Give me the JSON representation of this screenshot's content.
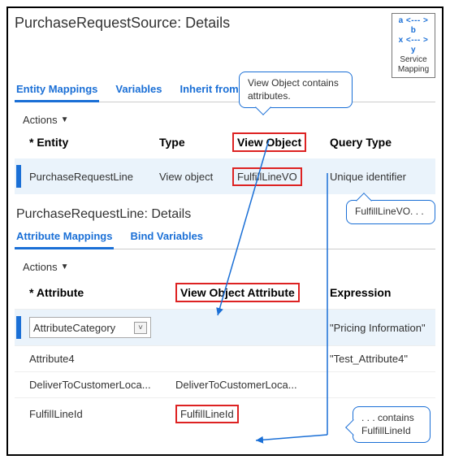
{
  "pageTitle": "PurchaseRequestSource: Details",
  "serviceMapping": {
    "line1": "a <--- > b",
    "line2": "x <--- > y",
    "label1": "Service",
    "label2": "Mapping"
  },
  "tabs": {
    "entityMappings": "Entity Mappings",
    "variables": "Variables",
    "inheritFromServices": "Inherit from Services"
  },
  "actionsLabel": "Actions",
  "entityGrid": {
    "headers": {
      "entity": "Entity",
      "type": "Type",
      "viewObject": "View Object",
      "queryType": "Query Type"
    },
    "row": {
      "entity": "PurchaseRequestLine",
      "type": "View object",
      "viewObject": "FulfillLineVO",
      "queryType": "Unique identifier"
    }
  },
  "subTitle": "PurchaseRequestLine: Details",
  "subTabs": {
    "attributeMappings": "Attribute Mappings",
    "bindVariables": "Bind Variables"
  },
  "attrGrid": {
    "headers": {
      "attribute": "Attribute",
      "viewObjectAttribute": "View Object Attribute",
      "expression": "Expression"
    },
    "rows": [
      {
        "attribute": "AttributeCategory",
        "voAttr": "",
        "expression": "\"Pricing Information\""
      },
      {
        "attribute": "Attribute4",
        "voAttr": "",
        "expression": "\"Test_Attribute4\""
      },
      {
        "attribute": "DeliverToCustomerLoca...",
        "voAttr": "DeliverToCustomerLoca...",
        "expression": ""
      },
      {
        "attribute": "FulfillLineId",
        "voAttr": "FulfillLineId",
        "expression": ""
      }
    ]
  },
  "callouts": {
    "top": "View Object contains attributes.",
    "right": "FulfillLineVO. . .",
    "bottom": ". . . contains FulfillLineId"
  }
}
